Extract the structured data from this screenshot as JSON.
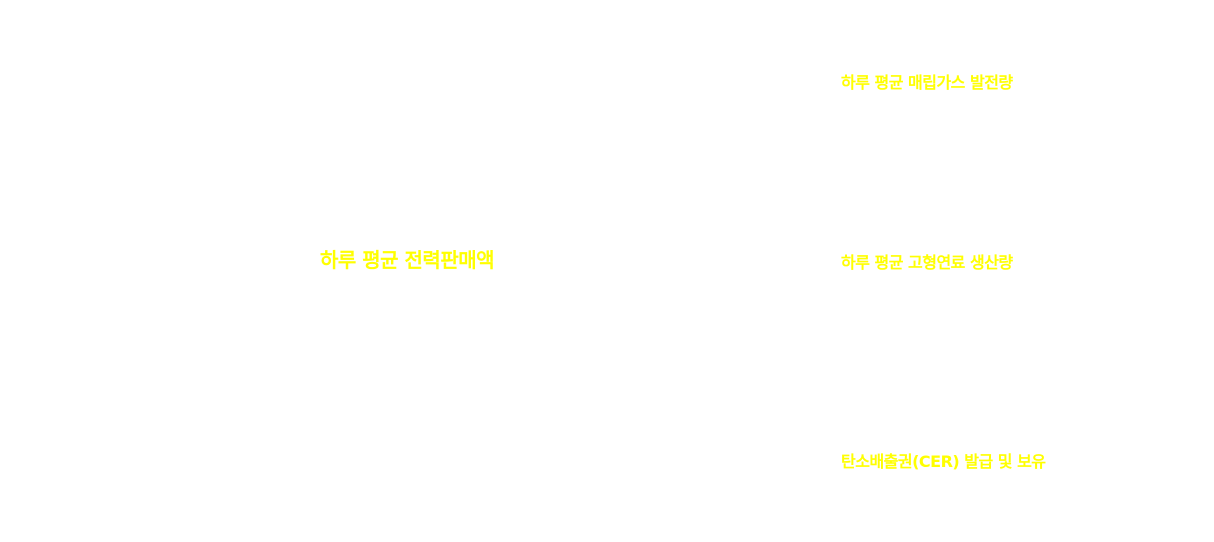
{
  "theme": {
    "label_color": "#ffff00",
    "background": "#ffffff"
  },
  "labels": {
    "main": "하루 평균 전력판매액",
    "landfill_gas": "하루 평균 매립가스 발전량",
    "solid_fuel": "하루 평균 고형연료 생산량",
    "cer": "탄소배출권(CER) 발급 및 보유"
  }
}
